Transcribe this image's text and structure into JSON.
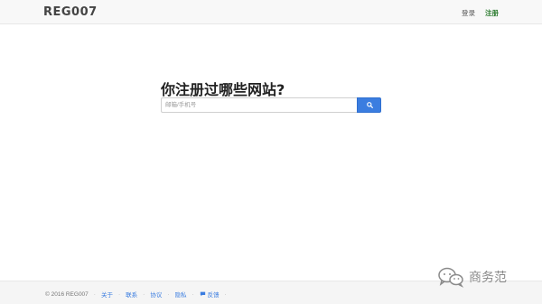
{
  "nav": {
    "brand": "REG007",
    "login_label": "登录",
    "register_label": "注册"
  },
  "hero": {
    "title": "你注册过哪些网站?"
  },
  "search": {
    "placeholder": "邮箱/手机号",
    "value": "",
    "button_icon": "search-icon"
  },
  "footer": {
    "copyright": "© 2016 REG007",
    "links": {
      "about": "关于",
      "contact": "联系",
      "agreement": "协议",
      "privacy": "隐私",
      "feedback": "反馈"
    },
    "separator": "·"
  },
  "watermark": {
    "text": "商务范",
    "icon": "wechat-logo"
  },
  "colors": {
    "accent": "#3b7de0",
    "register": "#2e7d32",
    "navbar_bg": "#f8f8f8",
    "footer_bg": "#f5f5f5"
  }
}
